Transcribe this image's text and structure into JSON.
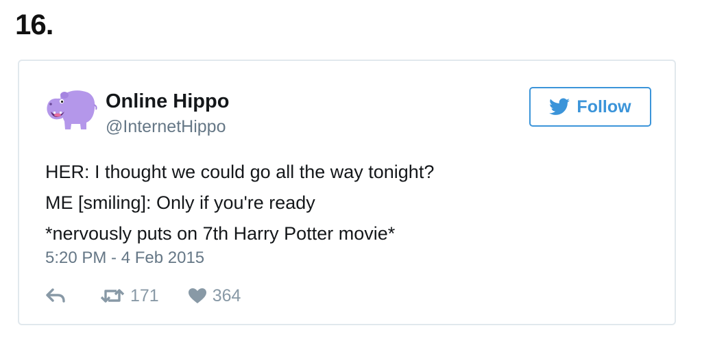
{
  "page": {
    "list_number": "16."
  },
  "tweet": {
    "author": {
      "display_name": "Online Hippo",
      "handle": "@InternetHippo",
      "avatar": "purple-hippo-avatar"
    },
    "follow_label": "Follow",
    "text_lines": [
      "HER: I thought we could go all the way tonight?",
      "ME [smiling]: Only if you're ready",
      "*nervously puts on 7th Harry Potter movie*"
    ],
    "timestamp": "5:20 PM - 4 Feb 2015",
    "actions": {
      "reply_icon": "reply-icon",
      "retweet_icon": "retweet-icon",
      "retweet_count": "171",
      "like_icon": "heart-icon",
      "like_count": "364"
    }
  },
  "colors": {
    "accent": "#3b94d9",
    "text": "#14171a",
    "muted": "#657786",
    "action_gray": "#8899a6",
    "border": "#e1e8ed",
    "avatar_purple": "#b497ea"
  }
}
